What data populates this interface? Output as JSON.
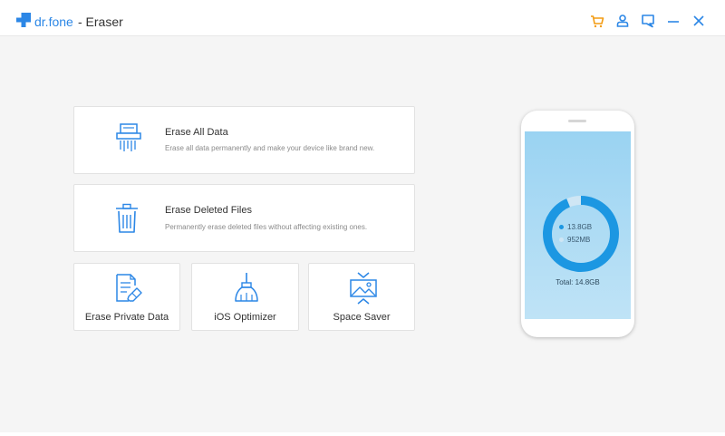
{
  "app": {
    "brand": "dr.fone",
    "title": "- Eraser"
  },
  "toolbar_icons": [
    "cart-icon",
    "account-icon",
    "feedback-icon",
    "minimize-icon",
    "close-icon"
  ],
  "cards": {
    "erase_all": {
      "title": "Erase All Data",
      "desc": "Erase all data permanently and make your device like brand new.",
      "icon": "shredder-icon"
    },
    "erase_deleted": {
      "title": "Erase Deleted Files",
      "desc": "Permanently erase deleted files without affecting existing ones.",
      "icon": "trash-icon"
    },
    "erase_private": {
      "title": "Erase Private Data",
      "icon": "document-eraser-icon"
    },
    "ios_optimizer": {
      "title": "iOS Optimizer",
      "icon": "broom-icon"
    },
    "space_saver": {
      "title": "Space Saver",
      "icon": "compress-photo-icon"
    }
  },
  "phone": {
    "used": "13.8GB",
    "free": "952MB",
    "total": "Total: 14.8GB",
    "used_fraction": 0.937
  },
  "colors": {
    "accent": "#2c87e6",
    "ring": "#1c97e2",
    "cart": "#f39c12",
    "free_dot": "#cfe6f4"
  }
}
